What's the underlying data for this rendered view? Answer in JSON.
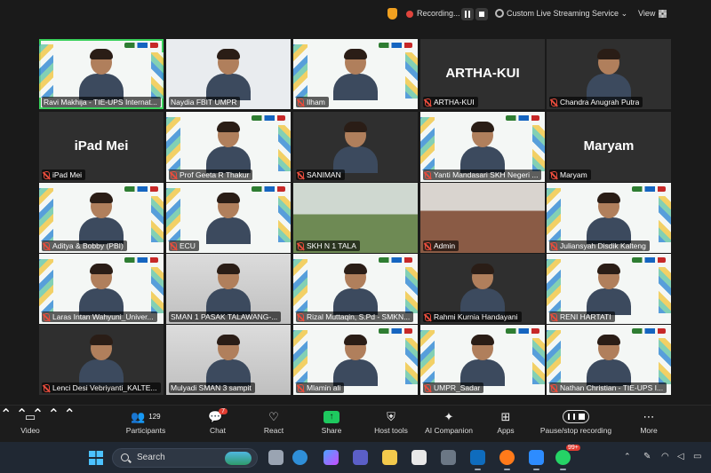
{
  "topbar": {
    "recording_label": "Recording...",
    "stream_label": "Custom Live Streaming Service",
    "view_label": "View"
  },
  "participants": [
    {
      "name": "Ravi Makhija - TIE-UPS Internat...",
      "display": "",
      "kind": "banner",
      "muted": false
    },
    {
      "name": "Naydia FBIT UMPR",
      "display": "",
      "kind": "light",
      "muted": false
    },
    {
      "name": "Ilham",
      "display": "",
      "kind": "banner",
      "muted": true
    },
    {
      "name": "ARTHA-KUI",
      "display": "ARTHA-KUI",
      "kind": "dark",
      "muted": true
    },
    {
      "name": "Chandra Anugrah Putra",
      "display": "",
      "kind": "dark",
      "muted": true
    },
    {
      "name": "iPad Mei",
      "display": "iPad Mei",
      "kind": "dark",
      "muted": true
    },
    {
      "name": "Prof Geeta R Thakur",
      "display": "",
      "kind": "banner",
      "muted": true
    },
    {
      "name": "SANIMAN",
      "display": "",
      "kind": "dark",
      "muted": true
    },
    {
      "name": "Yanti Mandasari SKH Negeri ...",
      "display": "",
      "kind": "banner",
      "muted": true
    },
    {
      "name": "Maryam",
      "display": "Maryam",
      "kind": "dark",
      "muted": true
    },
    {
      "name": "Aditya & Bobby (PBI)",
      "display": "",
      "kind": "banner",
      "muted": true
    },
    {
      "name": "ECU",
      "display": "",
      "kind": "banner",
      "muted": true
    },
    {
      "name": "SKH N 1 TALA",
      "display": "",
      "kind": "school",
      "muted": true
    },
    {
      "name": "Admin",
      "display": "",
      "kind": "room",
      "muted": true
    },
    {
      "name": "Juliansyah Disdik Kalteng",
      "display": "",
      "kind": "banner",
      "muted": true
    },
    {
      "name": "Laras Intan Wahyuni_Univer...",
      "display": "",
      "kind": "banner",
      "muted": true
    },
    {
      "name": "SMAN 1 PASAK TALAWANG-...",
      "display": "",
      "kind": "grey",
      "muted": false
    },
    {
      "name": "Rizal Muttaqin, S.Pd - SMKN...",
      "display": "",
      "kind": "banner",
      "muted": true
    },
    {
      "name": "Rahmi Kurnia Handayani",
      "display": "",
      "kind": "dark",
      "muted": true
    },
    {
      "name": "RENI HARTATI",
      "display": "",
      "kind": "banner",
      "muted": true
    },
    {
      "name": "Lenci Desi Vebriyanti_KALTE...",
      "display": "",
      "kind": "dark",
      "muted": true
    },
    {
      "name": "Mulyadi SMAN 3 sampit",
      "display": "",
      "kind": "grey",
      "muted": false
    },
    {
      "name": "Mlamin ali",
      "display": "",
      "kind": "banner",
      "muted": true
    },
    {
      "name": "UMPR_Sadar",
      "display": "",
      "kind": "banner",
      "muted": true
    },
    {
      "name": "Nathan Christian - TIE-UPS I...",
      "display": "",
      "kind": "banner",
      "muted": true
    }
  ],
  "toolbar": {
    "video": "Video",
    "participants": "Participants",
    "participants_count": "129",
    "chat": "Chat",
    "chat_badge": "7",
    "react": "React",
    "share": "Share",
    "host_tools": "Host tools",
    "ai_companion": "AI Companion",
    "apps": "Apps",
    "pause_recording": "Pause/stop recording",
    "more": "More"
  },
  "taskbar": {
    "search_placeholder": "Search",
    "whatsapp_badge": "99+"
  },
  "colors": {
    "active_speaker": "#3ad15c",
    "recording": "#e0443c",
    "share": "#1ec95f",
    "muted": "#e74c3c"
  }
}
